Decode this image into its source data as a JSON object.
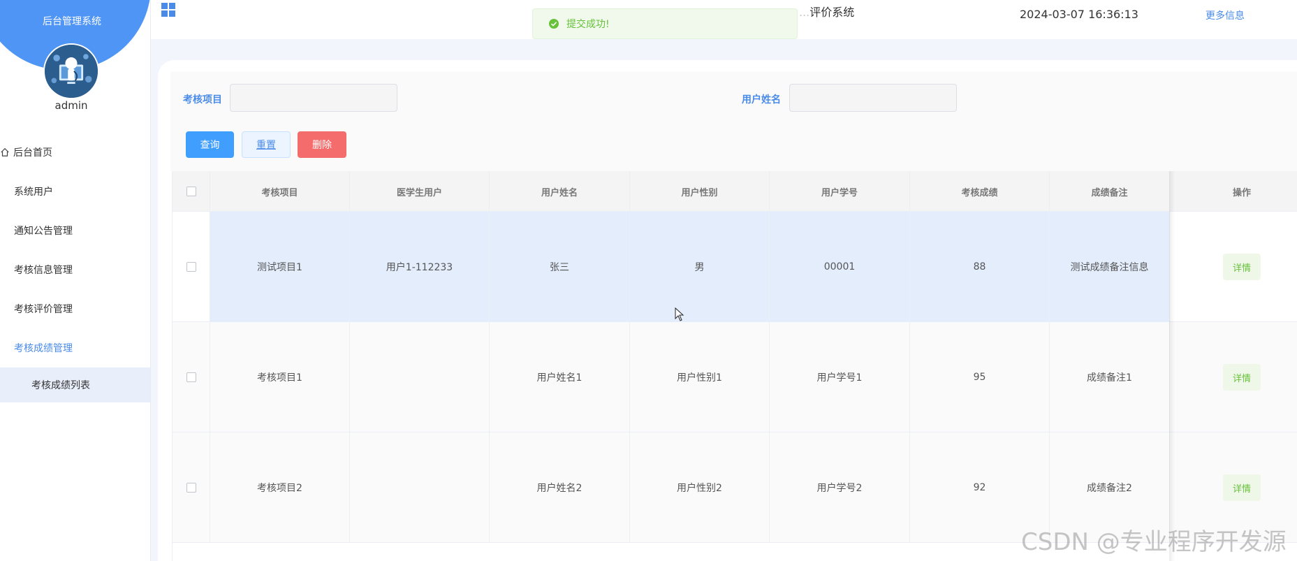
{
  "sidebar": {
    "system_title": "后台管理系统",
    "user_name": "admin",
    "menu": [
      {
        "label": "后台首页"
      },
      {
        "label": "系统用户"
      },
      {
        "label": "通知公告管理"
      },
      {
        "label": "考核信息管理"
      },
      {
        "label": "考核评价管理"
      },
      {
        "label": "考核成绩管理"
      }
    ],
    "submenu": [
      {
        "label": "考核成绩列表"
      }
    ]
  },
  "header": {
    "title_hidden": "...",
    "title_visible": "评价系统",
    "datetime": "2024-03-07 16:36:13",
    "more_link": "更多信息"
  },
  "toast": {
    "message": "提交成功!"
  },
  "search": {
    "label_project": "考核项目",
    "label_username": "用户姓名",
    "project_value": "",
    "username_value": "",
    "btn_query": "查询",
    "btn_reset": "重置",
    "btn_delete": "删除"
  },
  "table": {
    "columns": [
      "考核项目",
      "医学生用户",
      "用户姓名",
      "用户性别",
      "用户学号",
      "考核成绩",
      "成绩备注",
      "操作"
    ],
    "rows": [
      {
        "project": "测试项目1",
        "student_user": "用户1-112233",
        "name": "张三",
        "gender": "男",
        "student_no": "00001",
        "score": "88",
        "remark": "测试成绩备注信息",
        "action": "详情"
      },
      {
        "project": "考核项目1",
        "student_user": "",
        "name": "用户姓名1",
        "gender": "用户性别1",
        "student_no": "用户学号1",
        "score": "95",
        "remark": "成绩备注1",
        "action": "详情"
      },
      {
        "project": "考核项目2",
        "student_user": "",
        "name": "用户姓名2",
        "gender": "用户性别2",
        "student_no": "用户学号2",
        "score": "92",
        "remark": "成绩备注2",
        "action": "详情"
      }
    ]
  },
  "watermark": "CSDN @专业程序开发源",
  "colors": {
    "primary": "#409eff",
    "sidebar_accent": "#4f95f5",
    "success": "#67c23a",
    "danger": "#f56c6c",
    "highlight_row": "#e3edfc"
  }
}
